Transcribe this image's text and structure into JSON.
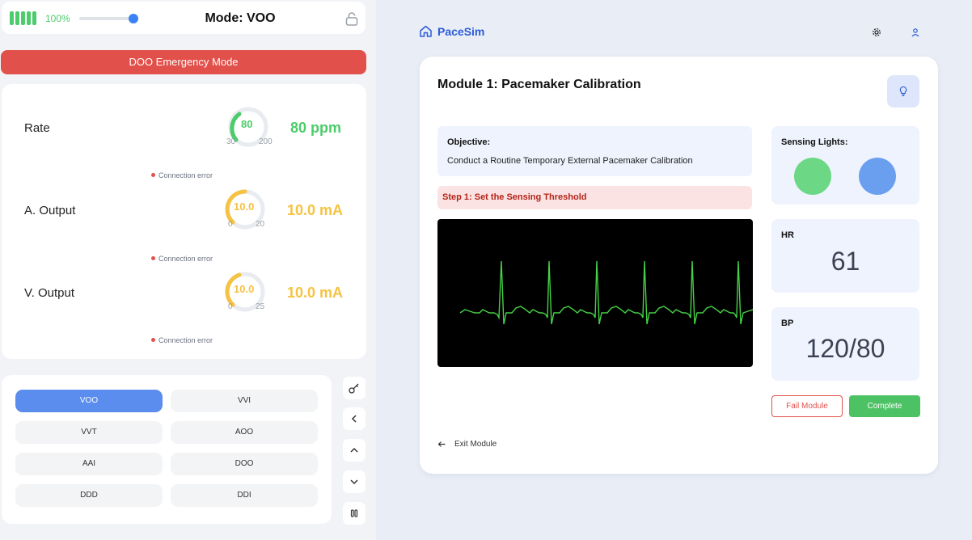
{
  "left": {
    "battery_pct": "100%",
    "battery_level": 1.0,
    "slider_level": 0.95,
    "mode_title": "Mode: VOO",
    "emergency_label": "DOO Emergency Mode",
    "params": [
      {
        "label": "Rate",
        "value": "80",
        "min": "30",
        "max": "200",
        "display": "80 ppm",
        "color": "#4ccc6b",
        "error": ""
      },
      {
        "label": "A. Output",
        "value": "10.0",
        "min": "0",
        "max": "20",
        "display": "10.0 mA",
        "color": "#f5c242",
        "error": "Connection error"
      },
      {
        "label": "V. Output",
        "value": "10.0",
        "min": "0",
        "max": "25",
        "display": "10.0 mA",
        "color": "#f5c242",
        "error": "Connection error"
      }
    ],
    "rate_error": "Connection error",
    "modes": [
      "VOO",
      "VVI",
      "VVT",
      "AOO",
      "AAI",
      "DOO",
      "DDD",
      "DDI"
    ],
    "active_mode": "VOO",
    "side_controls": [
      "key-icon",
      "chevron-left-icon",
      "chevron-up-icon",
      "chevron-down-icon",
      "pause-icon"
    ]
  },
  "header": {
    "brand": "PaceSim",
    "icons": [
      "settings-icon",
      "user-icon"
    ]
  },
  "module": {
    "title": "Module 1: Pacemaker Calibration",
    "objective_label": "Objective:",
    "objective_text": "Conduct a Routine Temporary External Pacemaker Calibration",
    "step": "Step 1: Set the Sensing Threshold",
    "sensing_label": "Sensing Lights:",
    "sensing_colors": [
      "#6cd886",
      "#6a9ff0"
    ],
    "hr_label": "HR",
    "hr_value": "61",
    "bp_label": "BP",
    "bp_value": "120/80",
    "fail_label": "Fail Module",
    "complete_label": "Complete",
    "exit_label": "Exit Module"
  }
}
